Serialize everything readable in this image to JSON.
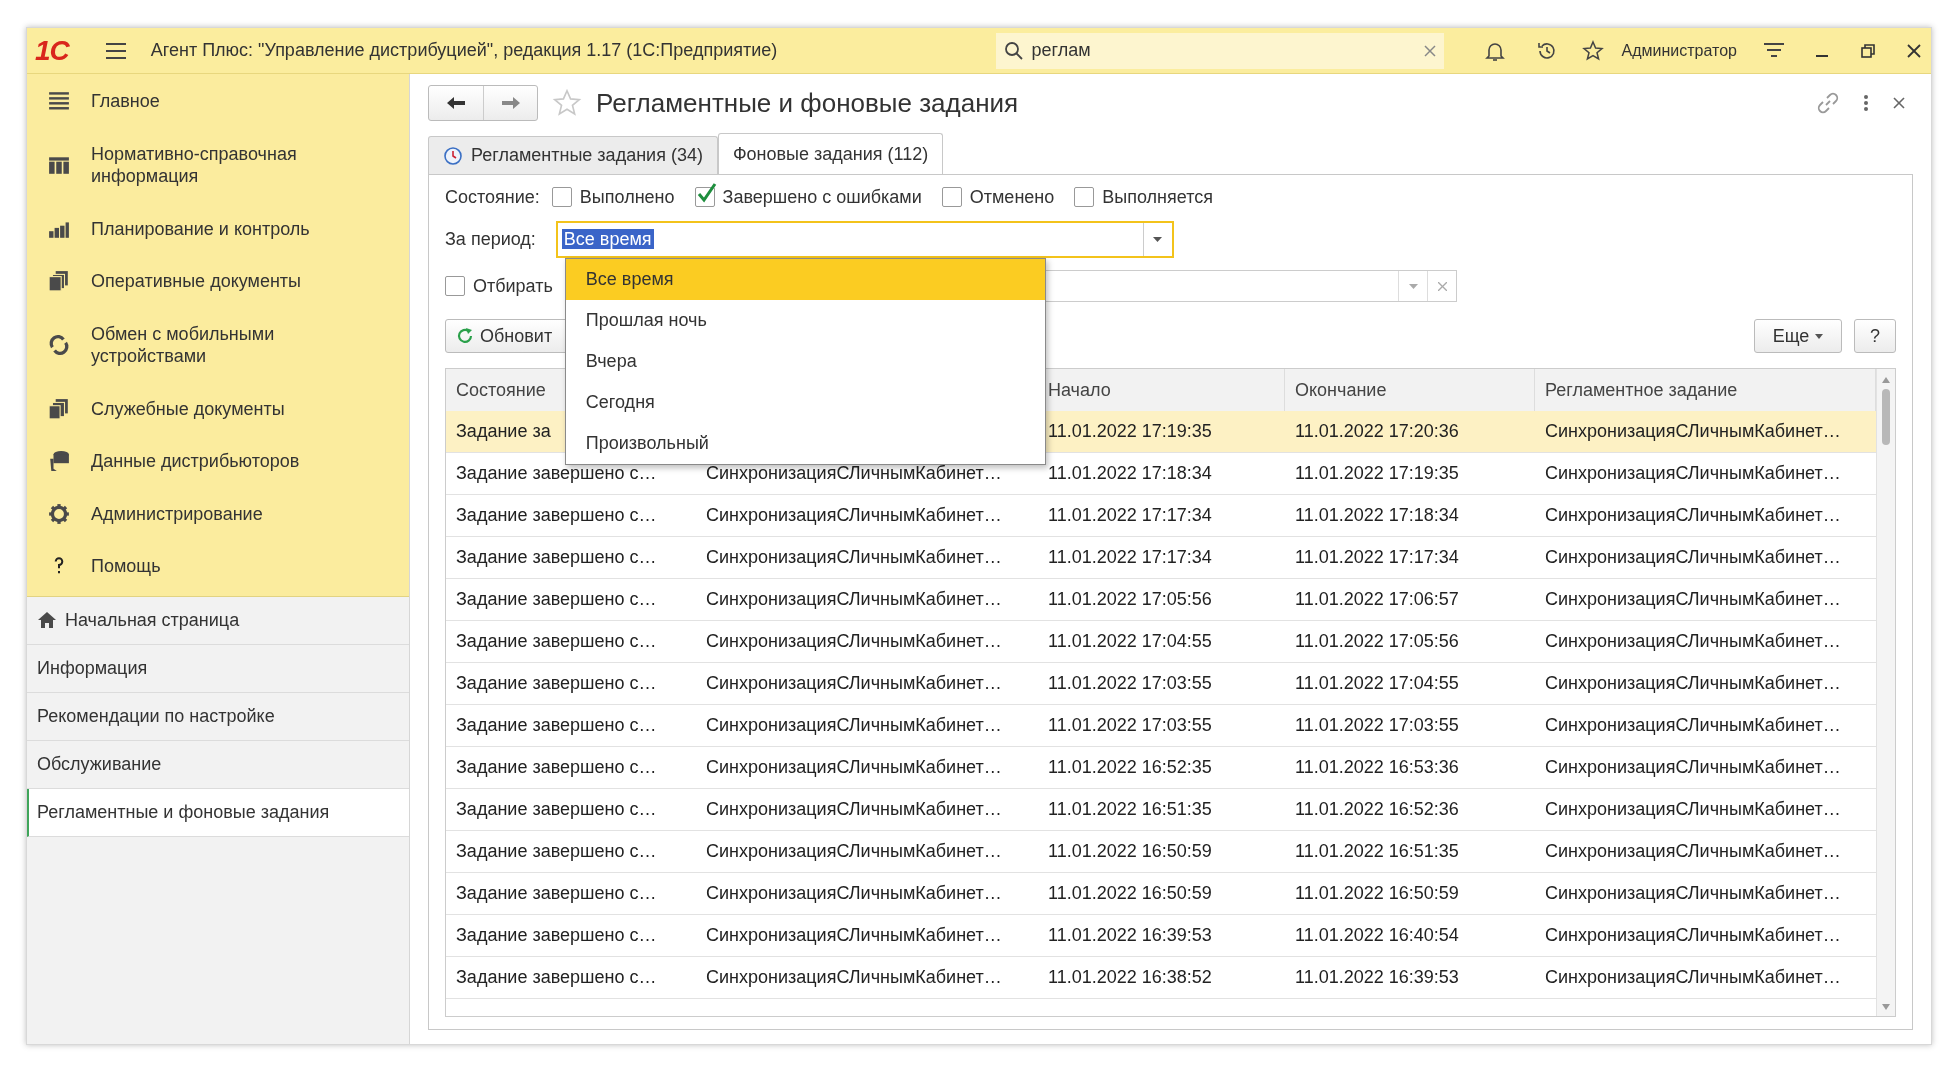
{
  "titlebar": {
    "logo": "1С",
    "title": "Агент Плюс: \"Управление дистрибуцией\", редакция 1.17  (1С:Предприятие)",
    "search": {
      "value": "реглам"
    },
    "user": "Администратор"
  },
  "sidebar": {
    "sections": [
      {
        "label": "Главное"
      },
      {
        "label": "Нормативно-справочная информация"
      },
      {
        "label": "Планирование и контроль"
      },
      {
        "label": "Оперативные документы"
      },
      {
        "label": "Обмен с мобильными устройствами"
      },
      {
        "label": "Служебные документы"
      },
      {
        "label": "Данные дистрибьюторов"
      },
      {
        "label": "Администрирование"
      },
      {
        "label": "Помощь"
      }
    ],
    "pages": [
      {
        "label": "Начальная страница",
        "home": true,
        "selected": false
      },
      {
        "label": "Информация",
        "home": false,
        "selected": false
      },
      {
        "label": "Рекомендации по настройке",
        "home": false,
        "selected": false
      },
      {
        "label": "Обслуживание",
        "home": false,
        "selected": false
      },
      {
        "label": "Регламентные и фоновые задания",
        "home": false,
        "selected": true
      }
    ]
  },
  "form": {
    "title": "Регламентные и фоновые задания",
    "tabs": [
      {
        "label": "Регламентные задания (34)",
        "selected": false
      },
      {
        "label": "Фоновые задания (112)",
        "selected": true
      }
    ],
    "state_label": "Состояние:",
    "states": [
      {
        "label": "Выполнено",
        "checked": false
      },
      {
        "label": "Завершено с ошибками",
        "checked": true
      },
      {
        "label": "Отменено",
        "checked": false
      },
      {
        "label": "Выполняется",
        "checked": false
      }
    ],
    "period": {
      "label": "За период:",
      "value": "Все время",
      "highlighted": true,
      "options": [
        {
          "label": "Все время",
          "selected": true
        },
        {
          "label": "Прошлая ночь",
          "selected": false
        },
        {
          "label": "Вчера",
          "selected": false
        },
        {
          "label": "Сегодня",
          "selected": false
        },
        {
          "label": "Произвольный",
          "selected": false
        }
      ]
    },
    "filter": {
      "label": "Отбирать",
      "checked": false
    },
    "refresh_button": "Обновит",
    "more_button": "Еще",
    "help_button": "?",
    "table": {
      "columns": [
        {
          "label": "Состояние"
        },
        {},
        {
          "label": "Начало"
        },
        {
          "label": "Окончание"
        },
        {
          "label": "Регламентное задание"
        }
      ],
      "rows": [
        {
          "selected": true,
          "cells": [
            "Задание за",
            "",
            "11.01.2022 17:19:35",
            "11.01.2022 17:20:36",
            "СинхронизацияСЛичнымКабинет…"
          ]
        },
        {
          "selected": false,
          "cells": [
            "Задание завершено с…",
            "СинхронизацияСЛичнымКабинет…",
            "11.01.2022 17:18:34",
            "11.01.2022 17:19:35",
            "СинхронизацияСЛичнымКабинет…"
          ]
        },
        {
          "selected": false,
          "cells": [
            "Задание завершено с…",
            "СинхронизацияСЛичнымКабинет…",
            "11.01.2022 17:17:34",
            "11.01.2022 17:18:34",
            "СинхронизацияСЛичнымКабинет…"
          ]
        },
        {
          "selected": false,
          "cells": [
            "Задание завершено с…",
            "СинхронизацияСЛичнымКабинет…",
            "11.01.2022 17:17:34",
            "11.01.2022 17:17:34",
            "СинхронизацияСЛичнымКабинет…"
          ]
        },
        {
          "selected": false,
          "cells": [
            "Задание завершено с…",
            "СинхронизацияСЛичнымКабинет…",
            "11.01.2022 17:05:56",
            "11.01.2022 17:06:57",
            "СинхронизацияСЛичнымКабинет…"
          ]
        },
        {
          "selected": false,
          "cells": [
            "Задание завершено с…",
            "СинхронизацияСЛичнымКабинет…",
            "11.01.2022 17:04:55",
            "11.01.2022 17:05:56",
            "СинхронизацияСЛичнымКабинет…"
          ]
        },
        {
          "selected": false,
          "cells": [
            "Задание завершено с…",
            "СинхронизацияСЛичнымКабинет…",
            "11.01.2022 17:03:55",
            "11.01.2022 17:04:55",
            "СинхронизацияСЛичнымКабинет…"
          ]
        },
        {
          "selected": false,
          "cells": [
            "Задание завершено с…",
            "СинхронизацияСЛичнымКабинет…",
            "11.01.2022 17:03:55",
            "11.01.2022 17:03:55",
            "СинхронизацияСЛичнымКабинет…"
          ]
        },
        {
          "selected": false,
          "cells": [
            "Задание завершено с…",
            "СинхронизацияСЛичнымКабинет…",
            "11.01.2022 16:52:35",
            "11.01.2022 16:53:36",
            "СинхронизацияСЛичнымКабинет…"
          ]
        },
        {
          "selected": false,
          "cells": [
            "Задание завершено с…",
            "СинхронизацияСЛичнымКабинет…",
            "11.01.2022 16:51:35",
            "11.01.2022 16:52:36",
            "СинхронизацияСЛичнымКабинет…"
          ]
        },
        {
          "selected": false,
          "cells": [
            "Задание завершено с…",
            "СинхронизацияСЛичнымКабинет…",
            "11.01.2022 16:50:59",
            "11.01.2022 16:51:35",
            "СинхронизацияСЛичнымКабинет…"
          ]
        },
        {
          "selected": false,
          "cells": [
            "Задание завершено с…",
            "СинхронизацияСЛичнымКабинет…",
            "11.01.2022 16:50:59",
            "11.01.2022 16:50:59",
            "СинхронизацияСЛичнымКабинет…"
          ]
        },
        {
          "selected": false,
          "cells": [
            "Задание завершено с…",
            "СинхронизацияСЛичнымКабинет…",
            "11.01.2022 16:39:53",
            "11.01.2022 16:40:54",
            "СинхронизацияСЛичнымКабинет…"
          ]
        },
        {
          "selected": false,
          "cells": [
            "Задание завершено с…",
            "СинхронизацияСЛичнымКабинет…",
            "11.01.2022 16:38:52",
            "11.01.2022 16:39:53",
            "СинхронизацияСЛичнымКабинет…"
          ]
        }
      ]
    }
  }
}
